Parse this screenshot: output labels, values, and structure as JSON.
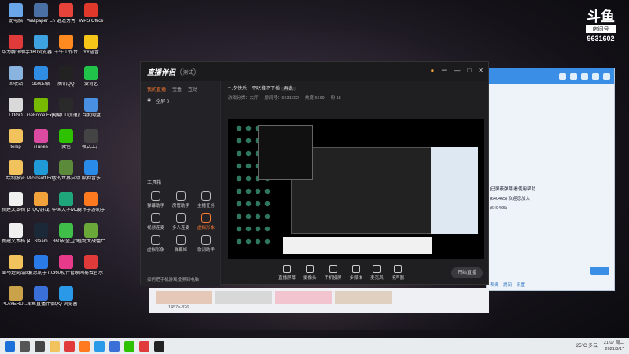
{
  "badge": {
    "logo": "斗鱼",
    "sub": "房间号",
    "room_number": "9631602"
  },
  "desktop_icons": [
    {
      "label": "此电脑",
      "color": "#6aa7e8",
      "col": 0,
      "row": 0
    },
    {
      "label": "Wallpaper Engine: ...",
      "color": "#4a6fa5",
      "col": 1,
      "row": 0
    },
    {
      "label": "逍遥秀秀",
      "color": "#e8433a",
      "col": 2,
      "row": 0
    },
    {
      "label": "WPS Office",
      "color": "#e0392b",
      "col": 3,
      "row": 0
    },
    {
      "label": "华为腾讯助手",
      "color": "#e03a3a",
      "col": 0,
      "row": 1
    },
    {
      "label": "360浏览器",
      "color": "#3ea1e0",
      "col": 1,
      "row": 1
    },
    {
      "label": "千牛工作台",
      "color": "#ff8a1f",
      "col": 2,
      "row": 1
    },
    {
      "label": "YY语音",
      "color": "#f5c518",
      "col": 3,
      "row": 1
    },
    {
      "label": "回收站",
      "color": "#8ab4e0",
      "col": 0,
      "row": 2
    },
    {
      "label": "360压缩",
      "color": "#2f8de4",
      "col": 1,
      "row": 2
    },
    {
      "label": "腾讯QQ",
      "color": "#222",
      "col": 2,
      "row": 2
    },
    {
      "label": "爱奇艺",
      "color": "#20c24a",
      "col": 3,
      "row": 2
    },
    {
      "label": "LOGO",
      "color": "#d9d9d9",
      "col": 0,
      "row": 3
    },
    {
      "label": "GeForce Experience",
      "color": "#76b900",
      "col": 1,
      "row": 3
    },
    {
      "label": "网易UU加速器",
      "color": "#2a2a2a",
      "col": 2,
      "row": 3
    },
    {
      "label": "百度网盘",
      "color": "#4a90e2",
      "col": 3,
      "row": 3
    },
    {
      "label": "temp",
      "color": "#f2c35c",
      "col": 0,
      "row": 4
    },
    {
      "label": "iTunes",
      "color": "#d94aa0",
      "col": 1,
      "row": 4
    },
    {
      "label": "微信",
      "color": "#2dc100",
      "col": 2,
      "row": 4
    },
    {
      "label": "格式工厂",
      "color": "#444",
      "col": 3,
      "row": 4
    },
    {
      "label": "绘制报告",
      "color": "#f2c35c",
      "col": 0,
      "row": 5
    },
    {
      "label": "Microsoft Edge",
      "color": "#1f9ad6",
      "col": 1,
      "row": 5
    },
    {
      "label": "我的世界启动器",
      "color": "#5a8a3a",
      "col": 2,
      "row": 5
    },
    {
      "label": "酷狗音乐",
      "color": "#2a8ae8",
      "col": 3,
      "row": 5
    },
    {
      "label": "新建文本档 (3)",
      "color": "#f0f0f0",
      "col": 0,
      "row": 6
    },
    {
      "label": "QQ游戏",
      "color": "#f2a23a",
      "col": 1,
      "row": 6
    },
    {
      "label": "中国大学MOOC",
      "color": "#1fa67a",
      "col": 2,
      "row": 6
    },
    {
      "label": "腾讯手游助手",
      "color": "#ff7a1f",
      "col": 3,
      "row": 6
    },
    {
      "label": "新建文本档 (4)",
      "color": "#f0f0f0",
      "col": 0,
      "row": 7
    },
    {
      "label": "Steam",
      "color": "#1b2838",
      "col": 1,
      "row": 7
    },
    {
      "label": "360安全卫士",
      "color": "#3fbf4a",
      "col": 2,
      "row": 7
    },
    {
      "label": "植物大战僵尸2010年度版",
      "color": "#6aa83a",
      "col": 3,
      "row": 7
    },
    {
      "label": "亚马逊商品图",
      "color": "#f2c35c",
      "col": 0,
      "row": 8
    },
    {
      "label": "爱思助手7.0",
      "color": "#2a7ae8",
      "col": 1,
      "row": 8
    },
    {
      "label": "360软件管家",
      "color": "#e83a8a",
      "col": 2,
      "row": 8
    },
    {
      "label": "网易云音乐",
      "color": "#e03a3a",
      "col": 3,
      "row": 8
    },
    {
      "label": "PLAYERU... BATTLEG...",
      "color": "#c9a24a",
      "col": 0,
      "row": 9
    },
    {
      "label": "斗鱼直播伴侣",
      "color": "#3a6fd8",
      "col": 1,
      "row": 9
    },
    {
      "label": "QQ 浏览器",
      "color": "#2a9ae8",
      "col": 2,
      "row": 9
    }
  ],
  "app": {
    "brand": "直播伴侣",
    "version": "测试",
    "tabs": [
      "我的直播",
      "宝盒",
      "互动"
    ],
    "scene_label": "全屏 0",
    "room_title": "七夕快乐！不吃推不下播",
    "room_tag": "再说",
    "room_meta": [
      "游戏分类：大厅",
      "房间号：9631602",
      "热度 6669",
      "粉 15"
    ],
    "tools_title": "工具箱",
    "tools": [
      {
        "label": "弹幕助手",
        "hot": false
      },
      {
        "label": "房管助手",
        "hot": false
      },
      {
        "label": "主播任务",
        "hot": false
      },
      {
        "label": "视频连麦",
        "hot": false
      },
      {
        "label": "多人连麦",
        "hot": false
      },
      {
        "label": "虚拟形象",
        "hot": true
      },
      {
        "label": "虚拟形象",
        "hot": false
      },
      {
        "label": "弹幕姬",
        "hot": false
      },
      {
        "label": "歌词助手",
        "hot": false
      }
    ],
    "left_footer": "如何把手机游戏投屏到电脑",
    "bottom_actions": [
      "直播屏幕",
      "摄像头",
      "手机投屏",
      "多媒体",
      "麦克风",
      "扬声器"
    ],
    "start_label": "开始直播"
  },
  "chat": {
    "lines": [
      "[已屏蔽弹幕]看使用帮助",
      "(640465) 欢迎您加入",
      "(640465)"
    ],
    "footer": [
      "表情",
      "提问",
      "设置"
    ]
  },
  "lower": {
    "text": "1457e-826"
  },
  "taskbar": {
    "weather": "25°C 多云",
    "time": "21:07 周二",
    "date": "2021/8/17"
  }
}
